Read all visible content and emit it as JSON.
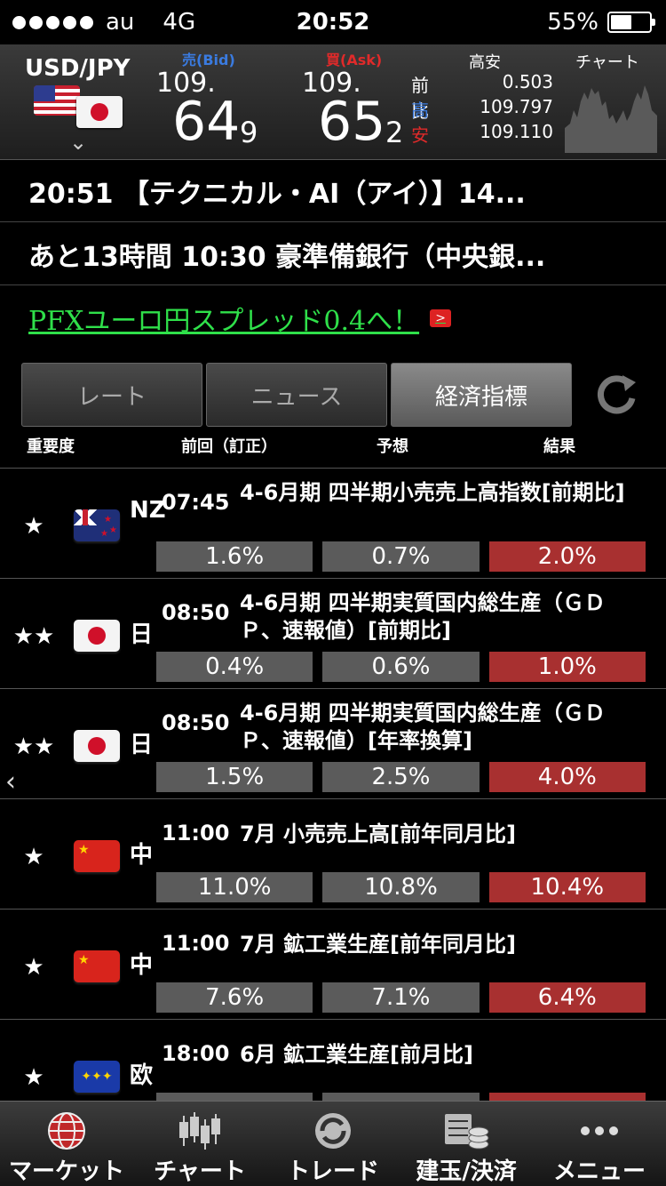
{
  "status_bar": {
    "carrier": "au",
    "network": "4G",
    "time": "20:52",
    "battery": "55%"
  },
  "rate": {
    "pair": "USD/JPY",
    "bid_label": "売(Bid)",
    "ask_label": "買(Ask)",
    "bid_small": "109.",
    "bid_big": "64",
    "bid_pip": "9",
    "ask_small": "109.",
    "ask_big": "65",
    "ask_pip": "2",
    "highlow_label": "高安",
    "chart_label": "チャート",
    "change_label": "前比",
    "change_value": "0.503",
    "high_label": "高",
    "high_value": "109.797",
    "low_label": "安",
    "low_value": "109.110"
  },
  "news": {
    "line1": "20:51 【テクニカル・AI（アイ）】14...",
    "line2": "あと13時間 10:30 豪準備銀行（中央銀..."
  },
  "promo": {
    "text": "PFXユーロ円スプレッド0.4へ！",
    "icon": ">"
  },
  "tabs": [
    {
      "label": "レート"
    },
    {
      "label": "ニュース"
    },
    {
      "label": "経済指標"
    }
  ],
  "columns": {
    "importance": "重要度",
    "previous": "前回（訂正）",
    "forecast": "予想",
    "result": "結果"
  },
  "events": [
    {
      "stars": "★",
      "flag": "nz",
      "country": "NZ",
      "time": "07:45",
      "title": "4-6月期 四半期小売売上高指数[前期比]",
      "previous": "1.6%",
      "forecast": "0.7%",
      "result": "2.0%"
    },
    {
      "stars": "★★",
      "flag": "jp",
      "country": "日",
      "time": "08:50",
      "title": "4-6月期 四半期実質国内総生産（ＧＤＰ、速報値）[前期比]",
      "previous": "0.4%",
      "forecast": "0.6%",
      "result": "1.0%"
    },
    {
      "stars": "★★",
      "flag": "jp",
      "country": "日",
      "time": "08:50",
      "title": "4-6月期 四半期実質国内総生産（ＧＤＰ、速報値）[年率換算]",
      "previous": "1.5%",
      "forecast": "2.5%",
      "result": "4.0%"
    },
    {
      "stars": "★",
      "flag": "cn",
      "country": "中",
      "time": "11:00",
      "title": "7月 小売売上高[前年同月比]",
      "previous": "11.0%",
      "forecast": "10.8%",
      "result": "10.4%"
    },
    {
      "stars": "★",
      "flag": "cn",
      "country": "中",
      "time": "11:00",
      "title": "7月 鉱工業生産[前年同月比]",
      "previous": "7.6%",
      "forecast": "7.1%",
      "result": "6.4%"
    },
    {
      "stars": "★",
      "flag": "eu",
      "country": "欧",
      "time": "18:00",
      "title": "6月 鉱工業生産[前月比]",
      "previous": "",
      "forecast": "",
      "result": ""
    }
  ],
  "bottom_nav": [
    {
      "label": "マーケット",
      "icon": "globe-icon"
    },
    {
      "label": "チャート",
      "icon": "candlestick-icon"
    },
    {
      "label": "トレード",
      "icon": "trade-icon"
    },
    {
      "label": "建玉/決済",
      "icon": "coins-icon"
    },
    {
      "label": "メニュー",
      "icon": "more-icon"
    }
  ],
  "colors": {
    "bid": "#3a7be0",
    "ask": "#e02a2a",
    "result_bg": "#a83030",
    "promo": "#2fe04a"
  }
}
